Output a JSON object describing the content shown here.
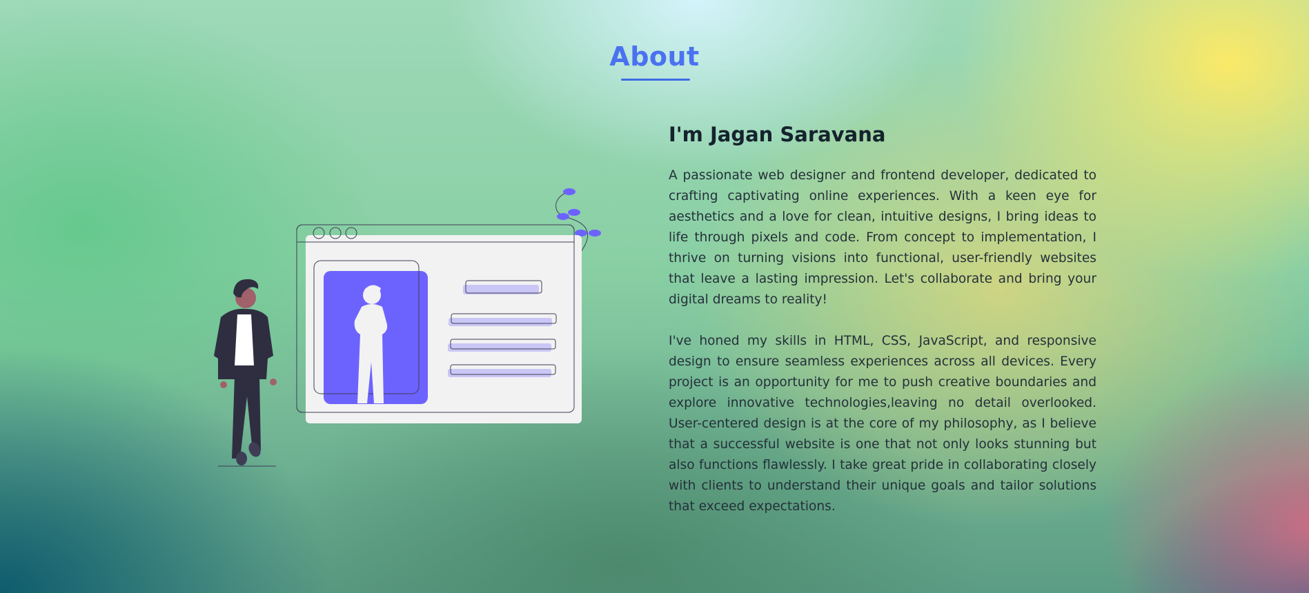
{
  "section": {
    "title": "About"
  },
  "profile": {
    "heading": "I'm Jagan Saravana",
    "paragraph_1": "A passionate web designer and frontend developer, dedicated to crafting captivating online experiences. With a keen eye for aesthetics and a love for clean, intuitive designs, I bring ideas to life through pixels and code. From concept to implementation, I thrive on turning visions into functional, user-friendly websites that leave a lasting impression. Let's collaborate and bring your digital dreams to reality!",
    "paragraph_2": "I've honed my skills in HTML, CSS, JavaScript, and responsive design to ensure seamless experiences across all devices. Every project is an opportunity for me to push creative boundaries and explore innovative technologies,leaving no detail overlooked. User-centered design is at the core of my philosophy, as I believe that a successful website is one that not only looks stunning but also functions flawlessly. I take great pride in collaborating closely with clients to understand their unique goals and tailor solutions that exceed expectations."
  },
  "illustration": {
    "icon": "person-with-profile-card-illustration",
    "accent_color": "#6c63ff",
    "card_color": "#f2f2f2",
    "person_jacket_color": "#2f2e41",
    "person_skin_color": "#a0616a"
  },
  "colors": {
    "title": "#4a72f0",
    "heading": "#15232d",
    "body_text": "#24303a"
  }
}
